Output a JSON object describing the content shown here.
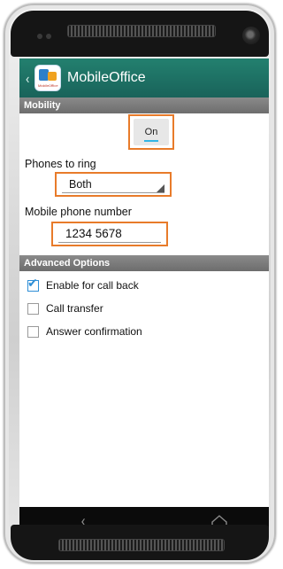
{
  "app": {
    "title": "MobileOffice",
    "icon_name": "mobileoffice-app-icon",
    "icon_caption": "MobileOffice"
  },
  "sections": {
    "mobility": "Mobility",
    "advanced": "Advanced Options"
  },
  "mobility": {
    "toggle_label": "On",
    "phones_to_ring_label": "Phones to ring",
    "phones_to_ring_value": "Both",
    "mobile_number_label": "Mobile phone number",
    "mobile_number_value": "1234 5678"
  },
  "advanced_options": [
    {
      "label": "Enable for call back",
      "checked": true
    },
    {
      "label": "Call transfer",
      "checked": false
    },
    {
      "label": "Answer confirmation",
      "checked": false
    }
  ],
  "colors": {
    "action_bar": "#1f7566",
    "highlight_border": "#e87b2a",
    "accent_blue": "#33b5e5"
  }
}
